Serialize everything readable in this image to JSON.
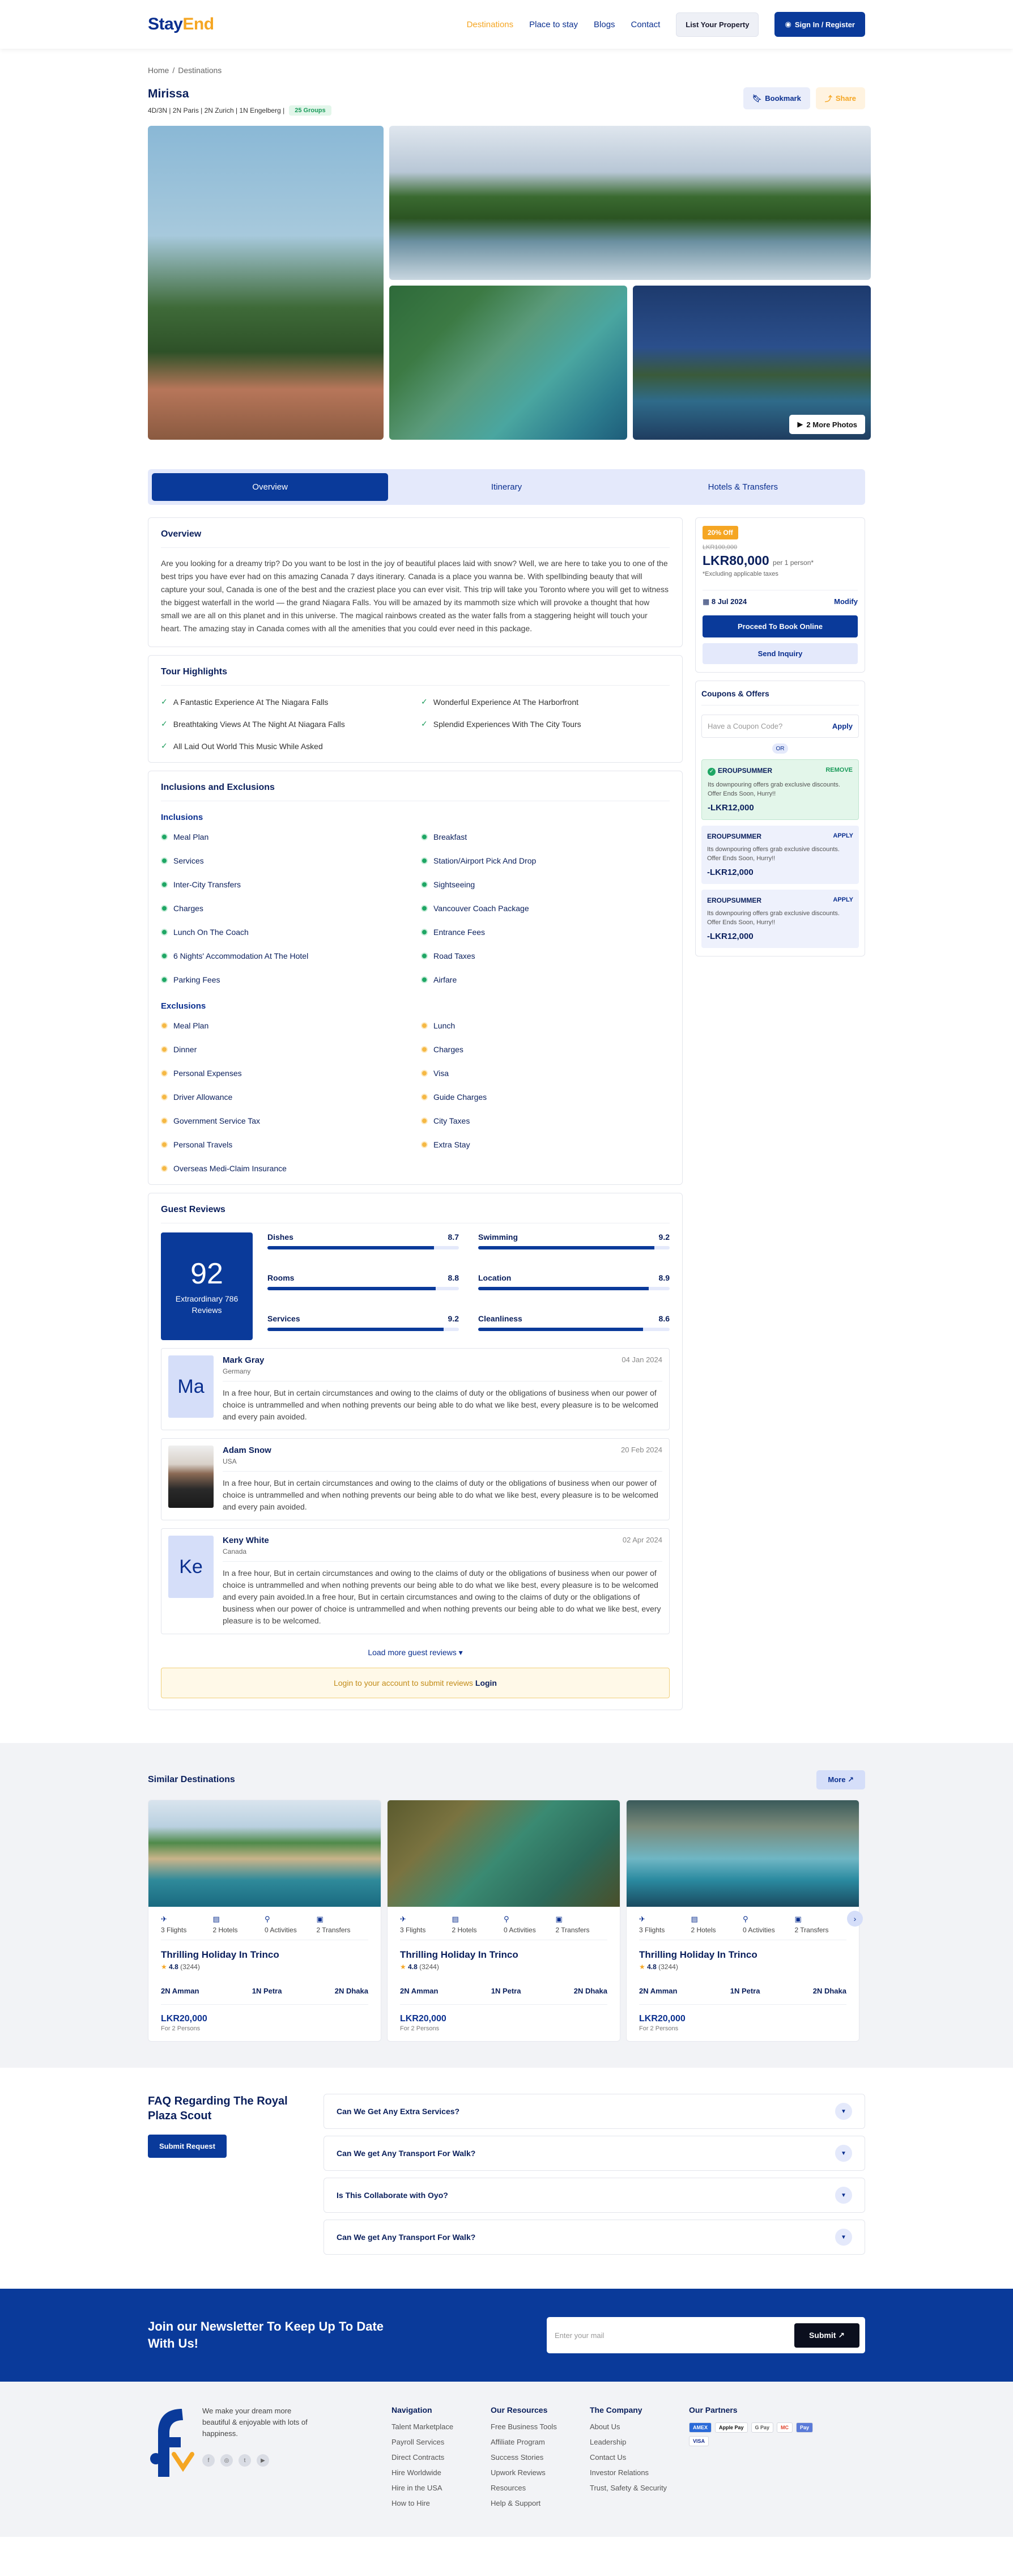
{
  "header": {
    "logo": {
      "part1": "Stay",
      "part2": "End"
    },
    "nav": [
      {
        "label": "Destinations",
        "active": true
      },
      {
        "label": "Place to stay",
        "active": false
      },
      {
        "label": "Blogs",
        "active": false
      },
      {
        "label": "Contact",
        "active": false
      }
    ],
    "list_property": "List Your Property",
    "sign_in": "Sign In / Register"
  },
  "breadcrumb": {
    "home": "Home",
    "sep": "/",
    "current": "Destinations"
  },
  "page": {
    "title": "Mirissa",
    "subtitle": "4D/3N | 2N Paris | 2N Zurich | 1N Engelberg |",
    "badge": "25 Groups",
    "bookmark": "Bookmark",
    "share": "Share",
    "more_photos": "2 More Photos"
  },
  "tabs": [
    "Overview",
    "Itinerary",
    "Hotels & Transfers"
  ],
  "overview": {
    "heading": "Overview",
    "text": "Are you looking for a dreamy trip? Do you want to be lost in the joy of beautiful places laid with snow? Well, we are here to take you to one of the best trips you have ever had on this amazing Canada 7 days itinerary. Canada is a place you wanna be. With spellbinding beauty that will capture your soul, Canada is one of the best and the craziest place you can ever visit. This trip will take you Toronto where you will get to witness the biggest waterfall in the world — the grand Niagara Falls. You will be amazed by its mammoth size which will provoke a thought that how small we are all on this planet and in this universe. The magical rainbows created as the water falls from a staggering height will touch your heart. The amazing stay in Canada comes with all the amenities that you could ever need in this package."
  },
  "highlights": {
    "heading": "Tour Highlights",
    "items": [
      "A Fantastic Experience At The Niagara Falls",
      "Wonderful Experience At The Harborfront",
      "Breathtaking Views At The Night At Niagara Falls",
      "Splendid Experiences With The City Tours",
      "All Laid Out World This Music While Asked"
    ]
  },
  "inclusions": {
    "heading": "Inclusions and Exclusions",
    "inc_label": "Inclusions",
    "inc": [
      "Meal Plan",
      "Breakfast",
      "Services",
      "Station/Airport Pick And Drop",
      "Inter-City Transfers",
      "Sightseeing",
      "Charges",
      "Vancouver Coach Package",
      "Lunch On The Coach",
      "Entrance Fees",
      "6 Nights' Accommodation At The Hotel",
      "Road Taxes",
      "Parking Fees",
      "Airfare"
    ],
    "exc_label": "Exclusions",
    "exc": [
      "Meal Plan",
      "Lunch",
      "Dinner",
      "Charges",
      "Personal Expenses",
      "Visa",
      "Driver Allowance",
      "Guide Charges",
      "Government Service Tax",
      "City Taxes",
      "Personal Travels",
      "Extra Stay",
      "Overseas Medi-Claim Insurance"
    ]
  },
  "reviews": {
    "heading": "Guest Reviews",
    "score": "92",
    "score_label": "Extraordinary 786 Reviews",
    "bars": [
      {
        "label": "Dishes",
        "value": 8.7
      },
      {
        "label": "Swimming",
        "value": 9.2
      },
      {
        "label": "Rooms",
        "value": 8.8
      },
      {
        "label": "Location",
        "value": 8.9
      },
      {
        "label": "Services",
        "value": 9.2
      },
      {
        "label": "Cleanliness",
        "value": 8.6
      }
    ],
    "items": [
      {
        "initials": "Ma",
        "name": "Mark Gray",
        "country": "Germany",
        "date": "04 Jan 2024",
        "photo": false,
        "text": "In a free hour, But in certain circumstances and owing to the claims of duty or the obligations of business when our power of choice is untrammelled and when nothing prevents our being able to do what we like best, every pleasure is to be welcomed and every pain avoided."
      },
      {
        "initials": "",
        "name": "Adam Snow",
        "country": "USA",
        "date": "20 Feb 2024",
        "photo": true,
        "text": "In a free hour, But in certain circumstances and owing to the claims of duty or the obligations of business when our power of choice is untrammelled and when nothing prevents our being able to do what we like best, every pleasure is to be welcomed and every pain avoided."
      },
      {
        "initials": "Ke",
        "name": "Keny White",
        "country": "Canada",
        "date": "02 Apr 2024",
        "photo": false,
        "text": "In a free hour, But in certain circumstances and owing to the claims of duty or the obligations of business when our power of choice is untrammelled and when nothing prevents our being able to do what we like best, every pleasure is to be welcomed and every pain avoided.In a free hour, But in certain circumstances and owing to the claims of duty or the obligations of business when our power of choice is untrammelled and when nothing prevents our being able to do what we like best, every pleasure is to be welcomed."
      }
    ],
    "load_more": "Load more guest reviews",
    "login_note": "Login to your account to submit reviews",
    "login_link": "Login"
  },
  "booking": {
    "discount": "20% Off",
    "old_price": "LKR100,000",
    "price": "LKR80,000",
    "per": "per 1 person*",
    "tax_note": "*Excluding applicable taxes",
    "date": "8 Jul 2024",
    "modify": "Modify",
    "proceed": "Proceed To Book Online",
    "enquiry": "Send Inquiry"
  },
  "coupons": {
    "heading": "Coupons & Offers",
    "placeholder": "Have a Coupon Code?",
    "apply": "Apply",
    "or": "OR",
    "items": [
      {
        "code": "EROUPSUMMER",
        "action": "REMOVE",
        "applied": true,
        "desc": "Its downpouring offers grab exclusive discounts. Offer Ends Soon, Hurry!!",
        "amount": "-LKR12,000"
      },
      {
        "code": "EROUPSUMMER",
        "action": "APPLY",
        "applied": false,
        "desc": "Its downpouring offers grab exclusive discounts. Offer Ends Soon, Hurry!!",
        "amount": "-LKR12,000"
      },
      {
        "code": "EROUPSUMMER",
        "action": "APPLY",
        "applied": false,
        "desc": "Its downpouring offers grab exclusive discounts. Offer Ends Soon, Hurry!!",
        "amount": "-LKR12,000"
      }
    ]
  },
  "similar": {
    "heading": "Similar Destinations",
    "more": "More",
    "cards": [
      {
        "flights": "3 Flights",
        "hotels": "2 Hotels",
        "activities": "0 Activities",
        "transfers": "2 Transfers",
        "title": "Thrilling Holiday In Trinco",
        "rating": "4.8",
        "count": "(3244)",
        "stops": [
          "2N Amman",
          "1N Petra",
          "2N Dhaka"
        ],
        "price": "LKR20,000",
        "for": "For 2 Persons"
      },
      {
        "flights": "3 Flights",
        "hotels": "2 Hotels",
        "activities": "0 Activities",
        "transfers": "2 Transfers",
        "title": "Thrilling Holiday In Trinco",
        "rating": "4.8",
        "count": "(3244)",
        "stops": [
          "2N Amman",
          "1N Petra",
          "2N Dhaka"
        ],
        "price": "LKR20,000",
        "for": "For 2 Persons"
      },
      {
        "flights": "3 Flights",
        "hotels": "2 Hotels",
        "activities": "0 Activities",
        "transfers": "2 Transfers",
        "title": "Thrilling Holiday In Trinco",
        "rating": "4.8",
        "count": "(3244)",
        "stops": [
          "2N Amman",
          "1N Petra",
          "2N Dhaka"
        ],
        "price": "LKR20,000",
        "for": "For 2 Persons"
      }
    ]
  },
  "faq": {
    "heading": "FAQ Regarding The Royal Plaza Scout",
    "submit": "Submit Request",
    "items": [
      "Can We Get Any Extra Services?",
      "Can We get Any Transport For Walk?",
      "Is This Collaborate with Oyo?",
      "Can We get Any Transport For Walk?"
    ]
  },
  "newsletter": {
    "heading": "Join our Newsletter To Keep Up To Date With Us!",
    "placeholder": "Enter your mail",
    "submit": "Submit ↗"
  },
  "footer": {
    "about": "We make your dream more beautiful & enjoyable with lots of happiness.",
    "columns": [
      {
        "title": "Navigation",
        "links": [
          "Talent Marketplace",
          "Payroll Services",
          "Direct Contracts",
          "Hire Worldwide",
          "Hire in the USA",
          "How to Hire"
        ]
      },
      {
        "title": "Our Resources",
        "links": [
          "Free Business Tools",
          "Affiliate Program",
          "Success Stories",
          "Upwork Reviews",
          "Resources",
          "Help & Support"
        ]
      },
      {
        "title": "The Company",
        "links": [
          "About Us",
          "Leadership",
          "Contact Us",
          "Investor Relations",
          "Trust, Safety & Security"
        ]
      }
    ],
    "partners_title": "Our Partners",
    "partners": [
      "AMEX",
      "Apple Pay",
      "G Pay",
      "MC",
      "Pay",
      "VISA"
    ]
  },
  "colors": {
    "primary": "#0a3a9a",
    "accent": "#f5a623",
    "success": "#1ea664"
  }
}
